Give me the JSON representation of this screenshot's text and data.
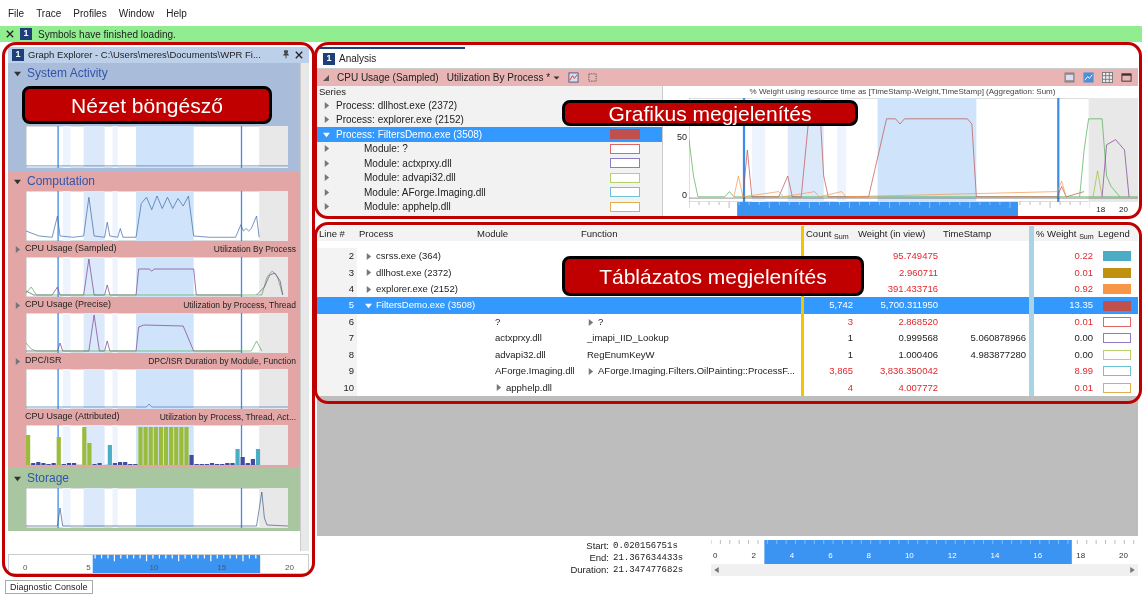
{
  "menu": [
    "File",
    "Trace",
    "Profiles",
    "Window",
    "Help"
  ],
  "notification": {
    "badge": "1",
    "text": "Symbols have finished loading."
  },
  "graph_explorer": {
    "badge": "1",
    "title": "Graph Explorer - C:\\Users\\meres\\Documents\\WPR Fi...",
    "groups": [
      {
        "name": "System Activity",
        "color": "#a9bcd9",
        "expanded": true,
        "graphs": [
          {
            "kind": "untitled"
          }
        ]
      },
      {
        "name": "Computation",
        "color": "#e3a6a6",
        "expanded": true,
        "graphs": [
          {
            "kind": "untitled"
          },
          {
            "kind": "titled",
            "title": "CPU Usage (Sampled)",
            "subtitle": "Utilization By Process",
            "expandable": true
          },
          {
            "kind": "titled",
            "title": "CPU Usage (Precise)",
            "subtitle": "Utilization by Process, Thread",
            "expandable": true
          },
          {
            "kind": "titled",
            "title": "DPC/ISR",
            "subtitle": "DPC/ISR Duration by Module, Function",
            "expandable": true
          },
          {
            "kind": "titled",
            "title": "CPU Usage (Attributed)",
            "subtitle": "Utilization by Process, Thread, Act...",
            "expandable": false
          }
        ]
      },
      {
        "name": "Storage",
        "color": "#a8c7a0",
        "expanded": true,
        "graphs": [
          {
            "kind": "untitled"
          }
        ]
      }
    ],
    "timeline_ticks": [
      "0",
      "5",
      "10",
      "15",
      "20"
    ]
  },
  "diagnostic_console": "Diagnostic Console",
  "analysis": {
    "tab": {
      "badge": "1",
      "label": "Analysis",
      "selected": true
    },
    "graph_name": "CPU Usage (Sampled)",
    "preset": "Utilization By Process *",
    "series_header": "Series",
    "series": [
      {
        "label": "Process: dllhost.exe (2372)",
        "expanded": false,
        "selected": false
      },
      {
        "label": "Process: explorer.exe (2152)",
        "expanded": false,
        "selected": false
      },
      {
        "label": "Process: FiltersDemo.exe (3508)",
        "expanded": true,
        "selected": true,
        "color": "#c0504d",
        "filled": true,
        "children": [
          {
            "label": "Module: ?",
            "expanded": false,
            "selected": false,
            "color": "#e06666",
            "filled": false
          },
          {
            "label": "Module: actxprxy.dll",
            "expanded": false,
            "selected": false,
            "color": "#8e7cc3",
            "filled": false
          },
          {
            "label": "Module: advapi32.dll",
            "expanded": false,
            "selected": false,
            "color": "#b6d36b",
            "filled": false
          },
          {
            "label": "Module: AForge.Imaging.dll",
            "expanded": false,
            "selected": false,
            "color": "#6cc3d8",
            "filled": false
          },
          {
            "label": "Module: apphelp.dll",
            "expanded": false,
            "selected": false,
            "color": "#e0b050",
            "filled": false
          }
        ]
      }
    ],
    "chart_title": "% Weight using resource time as [TimeStamp-Weight,TimeStamp] (Aggregation: Sum)",
    "y_axis_labels": [
      "50",
      "0"
    ],
    "x_axis_labels": [
      "18",
      "20"
    ],
    "table": {
      "columns": [
        "Line #",
        "Process",
        "Module",
        "Function",
        "Count $_{Sum}$",
        "Weight (in view)",
        "TimeStamp",
        "% Weight $_{Sum}$",
        "Legend"
      ],
      "rows": [
        {
          "line": "2",
          "process": "csrss.exe (364)",
          "process_expanded": false,
          "weight": "95.749475",
          "pct": "0.22",
          "emphasis": true,
          "selected": false,
          "color": "#4bacc6",
          "filled": true
        },
        {
          "line": "3",
          "process": "dllhost.exe (2372)",
          "process_expanded": false,
          "weight": "2.960711",
          "pct": "0.01",
          "emphasis": true,
          "selected": false,
          "color": "#c09010",
          "filled": true
        },
        {
          "line": "4",
          "process": "explorer.exe (2152)",
          "process_expanded": false,
          "weight": "391.433716",
          "pct": "0.92",
          "emphasis": true,
          "selected": false,
          "color": "#f79646",
          "filled": true
        },
        {
          "line": "5",
          "process": "FiltersDemo.exe (3508)",
          "process_expanded": true,
          "count": "5,742",
          "weight": "5,700.311950",
          "pct": "13.35",
          "selected": true,
          "color": "#c0504d",
          "filled": true
        },
        {
          "line": "6",
          "module": "?",
          "function": "?",
          "function_expanded": false,
          "count": "3",
          "weight": "2.868520",
          "pct": "0.01",
          "emphasis": true,
          "selected": false,
          "color": "#e06666",
          "filled": false
        },
        {
          "line": "7",
          "module": "actxprxy.dll",
          "function": "_imapi_IID_Lookup",
          "count": "1",
          "weight": "0.999568",
          "timestamp": "5.060878966",
          "pct": "0.00",
          "emphasis": false,
          "selected": false,
          "color": "#8e7cc3",
          "filled": false
        },
        {
          "line": "8",
          "module": "advapi32.dll",
          "function": "RegEnumKeyW",
          "count": "1",
          "weight": "1.000406",
          "timestamp": "4.983877280",
          "pct": "0.00",
          "emphasis": false,
          "selected": false,
          "color": "#b6d36b",
          "filled": false
        },
        {
          "line": "9",
          "module": "AForge.Imaging.dll",
          "function": "AForge.Imaging.Filters.OilPainting::ProcessF...",
          "function_expanded": false,
          "count": "3,865",
          "weight": "3,836.350042",
          "pct": "8.99",
          "emphasis": true,
          "selected": false,
          "color": "#6cc3d8",
          "filled": false
        },
        {
          "line": "10",
          "module": "apphelp.dll",
          "module_expanded": false,
          "count": "4",
          "weight": "4.007772",
          "pct": "0.01",
          "emphasis": true,
          "selected": false,
          "color": "#e0b050",
          "filled": false
        }
      ]
    },
    "selection": [
      {
        "label": "Start:",
        "value": "0.020156751s"
      },
      {
        "label": "End:",
        "value": "21.367634433s"
      },
      {
        "label": "Duration:",
        "value": "21.347477682s"
      }
    ],
    "timeline_ticks": [
      "0",
      "2",
      "4",
      "6",
      "8",
      "10",
      "12",
      "14",
      "16",
      "18",
      "20"
    ]
  },
  "callouts": [
    {
      "text": "Nézet böngésző"
    },
    {
      "text": "Grafikus megjelenítés"
    },
    {
      "text": "Táblázatos megjelenítés"
    }
  ]
}
